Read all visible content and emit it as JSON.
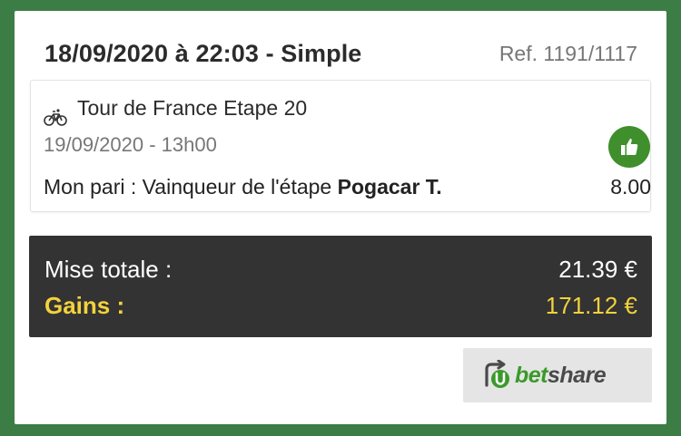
{
  "header": {
    "title": "18/09/2020 à 22:03 - Simple",
    "ref": "Ref. 1191/1117"
  },
  "bet": {
    "sport_icon": "bicycle-icon",
    "event": "Tour de France Etape 20",
    "date": "19/09/2020 - 13h00",
    "status_icon": "thumbs-up-icon",
    "status_color": "#3f8f2c",
    "line_prefix": "Mon pari : Vainqueur de l'étape ",
    "pick": "Pogacar T.",
    "odds": "8.00"
  },
  "summary": {
    "stake_label": "Mise totale :",
    "stake_value": "21.39 €",
    "gain_label": "Gains :",
    "gain_value": "171.12 €",
    "gain_color": "#f3d23c"
  },
  "betshare": {
    "icon": "betshare-logo-icon",
    "bet_text": "bet",
    "share_text": "share"
  }
}
